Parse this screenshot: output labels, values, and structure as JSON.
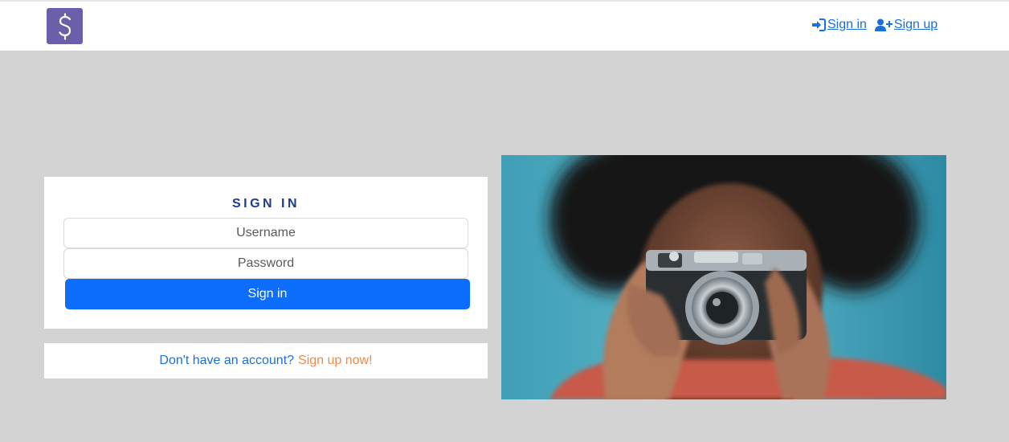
{
  "brand": {
    "icon": "dollar-icon",
    "color": "#6a5fa8"
  },
  "nav": {
    "signin_label": "Sign in",
    "signup_label": "Sign up",
    "link_color": "#1a6fd8"
  },
  "signin_form": {
    "title": "SIGN IN",
    "username_placeholder": "Username",
    "password_placeholder": "Password",
    "button_label": "Sign in",
    "button_color": "#0d6efd"
  },
  "signup_prompt": {
    "text": "Don't have an account?",
    "link": "Sign up now!",
    "link_color": "#f08a4b"
  },
  "hero_image": {
    "subject": "person holding a camera"
  }
}
